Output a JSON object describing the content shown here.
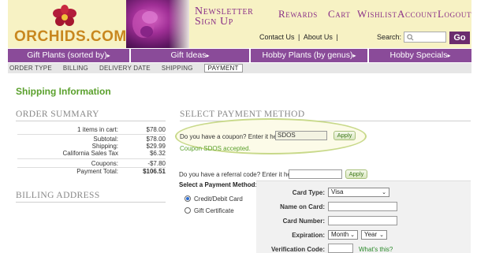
{
  "header": {
    "logo_text": "ORCHIDS.COM",
    "nav": {
      "newsletter": "Newsletter Sign Up",
      "rewards": "Rewards",
      "cart": "Cart",
      "wishlist": "Wishlist",
      "account": "Account",
      "logout": "Logout"
    },
    "contact": "Contact Us",
    "about": "About Us",
    "sep": "|",
    "search_label": "Search:",
    "search_placeholder": "",
    "go": "Go"
  },
  "menu": [
    {
      "label": "Gift Plants (sorted by)",
      "arrow": "▸"
    },
    {
      "label": "Gift Ideas",
      "arrow": "▸"
    },
    {
      "label": "Hobby Plants (by genus)",
      "arrow": "▸"
    },
    {
      "label": "Hobby Specials",
      "arrow": "▸"
    }
  ],
  "steps": [
    "ORDER TYPE",
    "BILLING",
    "DELIVERY DATE",
    "SHIPPING",
    "PAYMENT"
  ],
  "page_title": "Shipping Information",
  "order_summary": {
    "heading": "ORDER SUMMARY",
    "rows": [
      {
        "label": "1 items in cart:",
        "value": "$78.00"
      },
      {
        "label": "Subtotal:",
        "value": "$78.00"
      },
      {
        "label": "Shipping:",
        "value": "$29.99"
      },
      {
        "label": "California Sales Tax",
        "value": "$6.32"
      },
      {
        "label": "Coupons:",
        "value": "-$7.80"
      },
      {
        "label": "Payment Total:",
        "value": "$106.51"
      }
    ]
  },
  "billing_heading": "BILLING ADDRESS",
  "payment": {
    "heading": "SELECT PAYMENT METHOD",
    "coupon_prompt": "Do you have a coupon? Enter it here:",
    "coupon_value": "SDOS",
    "apply": "Apply",
    "coupon_ok": "Coupon SDOS accepted.",
    "referral_prompt": "Do you have a referral code? Enter it here:",
    "select_method": "Select a Payment Method:",
    "methods": [
      "Credit/Debit Card",
      "Gift Certificate"
    ],
    "card_type_label": "Card Type:",
    "card_type_value": "Visa",
    "name_label": "Name on Card:",
    "number_label": "Card Number:",
    "expiration_label": "Expiration:",
    "month": "Month",
    "year": "Year",
    "verification_label": "Verification Code:",
    "whats_this": "What's this?"
  }
}
